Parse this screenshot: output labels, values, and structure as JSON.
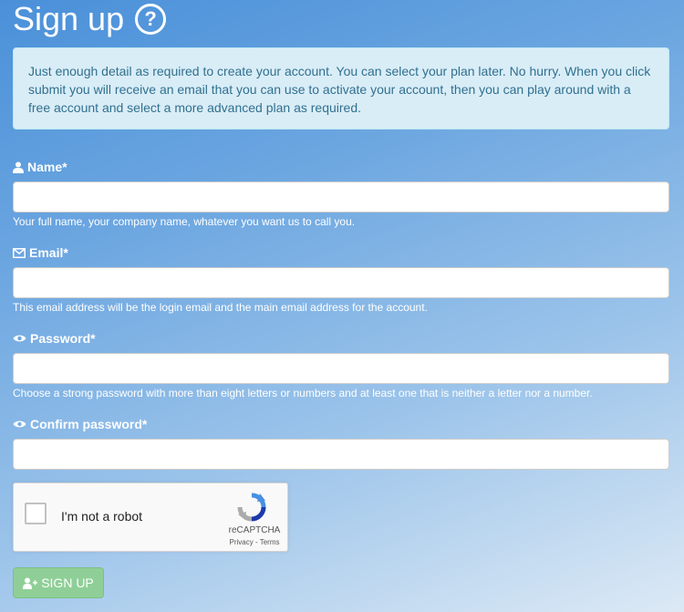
{
  "page": {
    "title": "Sign up",
    "help_glyph": "?",
    "intro": "Just enough detail as required to create your account. You can select your plan later. No hurry. When you click submit you will receive an email that you can use to activate your account, then you can play around with a free account and select a more advanced plan as required."
  },
  "form": {
    "name": {
      "label": "Name*",
      "icon": "user-icon",
      "value": "",
      "help": "Your full name, your company name, whatever you want us to call you."
    },
    "email": {
      "label": "Email*",
      "icon": "envelope-icon",
      "value": "",
      "help": "This email address will be the login email and the main email address for the account."
    },
    "password": {
      "label": "Password*",
      "icon": "eye-icon",
      "value": "",
      "help": "Choose a strong password with more than eight letters or numbers and at least one that is neither a letter nor a number."
    },
    "confirm_password": {
      "label": "Confirm password*",
      "icon": "eye-icon",
      "value": ""
    }
  },
  "captcha": {
    "label": "I'm not a robot",
    "brand": "reCAPTCHA",
    "terms": "Privacy - Terms",
    "checked": false
  },
  "submit": {
    "label": "SIGN UP",
    "icon": "user-plus-icon"
  }
}
